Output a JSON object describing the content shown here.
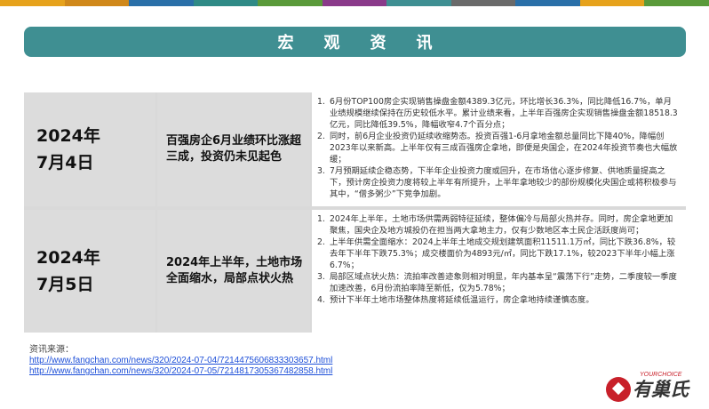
{
  "colors": {
    "banner": "#3f8f92",
    "top_stripe": [
      "#e6a21c",
      "#d0881a",
      "#2a6fa8",
      "#2f8a86",
      "#5a9a3a",
      "#8a3a8a",
      "#3f8f92",
      "#6a6a6a",
      "#2a6fa8",
      "#e6a21c",
      "#5a9a3a"
    ]
  },
  "header": {
    "title": "宏观资讯"
  },
  "rows": [
    {
      "date_line1": "2024年",
      "date_line2": "7月4日",
      "title": "百强房企6月业绩环比涨超三成，投资仍未见起色",
      "items": [
        "1.|6月份TOP100房企实现销售操盘金额4389.3亿元，环比增长36.3%，同比降低16.7%，单月业绩规模继续保持在历史较低水平。累计业绩来看，上半年百强房企实现销售操盘金额18518.3亿元，同比降低39.5%，降幅收窄4.7个百分点；",
        "2.|同时，前6月企业投资仍延续收缩势态。投资百强1-6月拿地金额总量同比下降40%，降幅创2023年以来新高。上半年仅有三成百强房企拿地，即便是央国企，在2024年投资节奏也大幅放缓；",
        "3.|7月预期延续企稳态势，下半年企业投资力度或回升，在市场信心逐步修复、供地质量提高之下，预计房企投资力度将较上半年有所提升，上半年拿地较少的部份规模化央国企或将积极参与其中，“僧多粥少”下竞争加剧。"
      ]
    },
    {
      "date_line1": "2024年",
      "date_line2": "7月5日",
      "title": "2024年上半年，土地市场全面缩水，局部点状火热",
      "items": [
        "1.|2024年上半年，土地市场供需两弱特征延续，整体偏冷与局部火热并存。同时，房企拿地更加聚焦，国央企及地方城投仍在担当两大拿地主力，仅有少数地区本土民企活跃度尚可；",
        "2.|上半年供需全面缩水：2024上半年土地成交规划建筑面积11511.1万㎡，同比下跌36.8%，较去年下半年下跌75.3%；成交楼面价为4893元/㎡，同比下跌17.1%，较2023下半年小幅上涨6.7%；",
        "3.|局部区域点状火热：流拍率改善迹象则相对明显，年内基本呈“震荡下行”走势，二季度较一季度加速改善，6月份流拍率降至新低，仅为5.78%；",
        "4.|预计下半年土地市场整体热度将延续低温运行，房企拿地持续谨慎态度。"
      ]
    }
  ],
  "source": {
    "label": "资讯来源：",
    "links": [
      "http://www.fangchan.com/news/320/2024-07-04/7214475606833303657.html",
      "http://www.fangchan.com/news/320/2024-07-05/7214817305367482858.html"
    ]
  },
  "logo": {
    "brand": "有巢氏",
    "sub": "YOURCHOICE"
  }
}
